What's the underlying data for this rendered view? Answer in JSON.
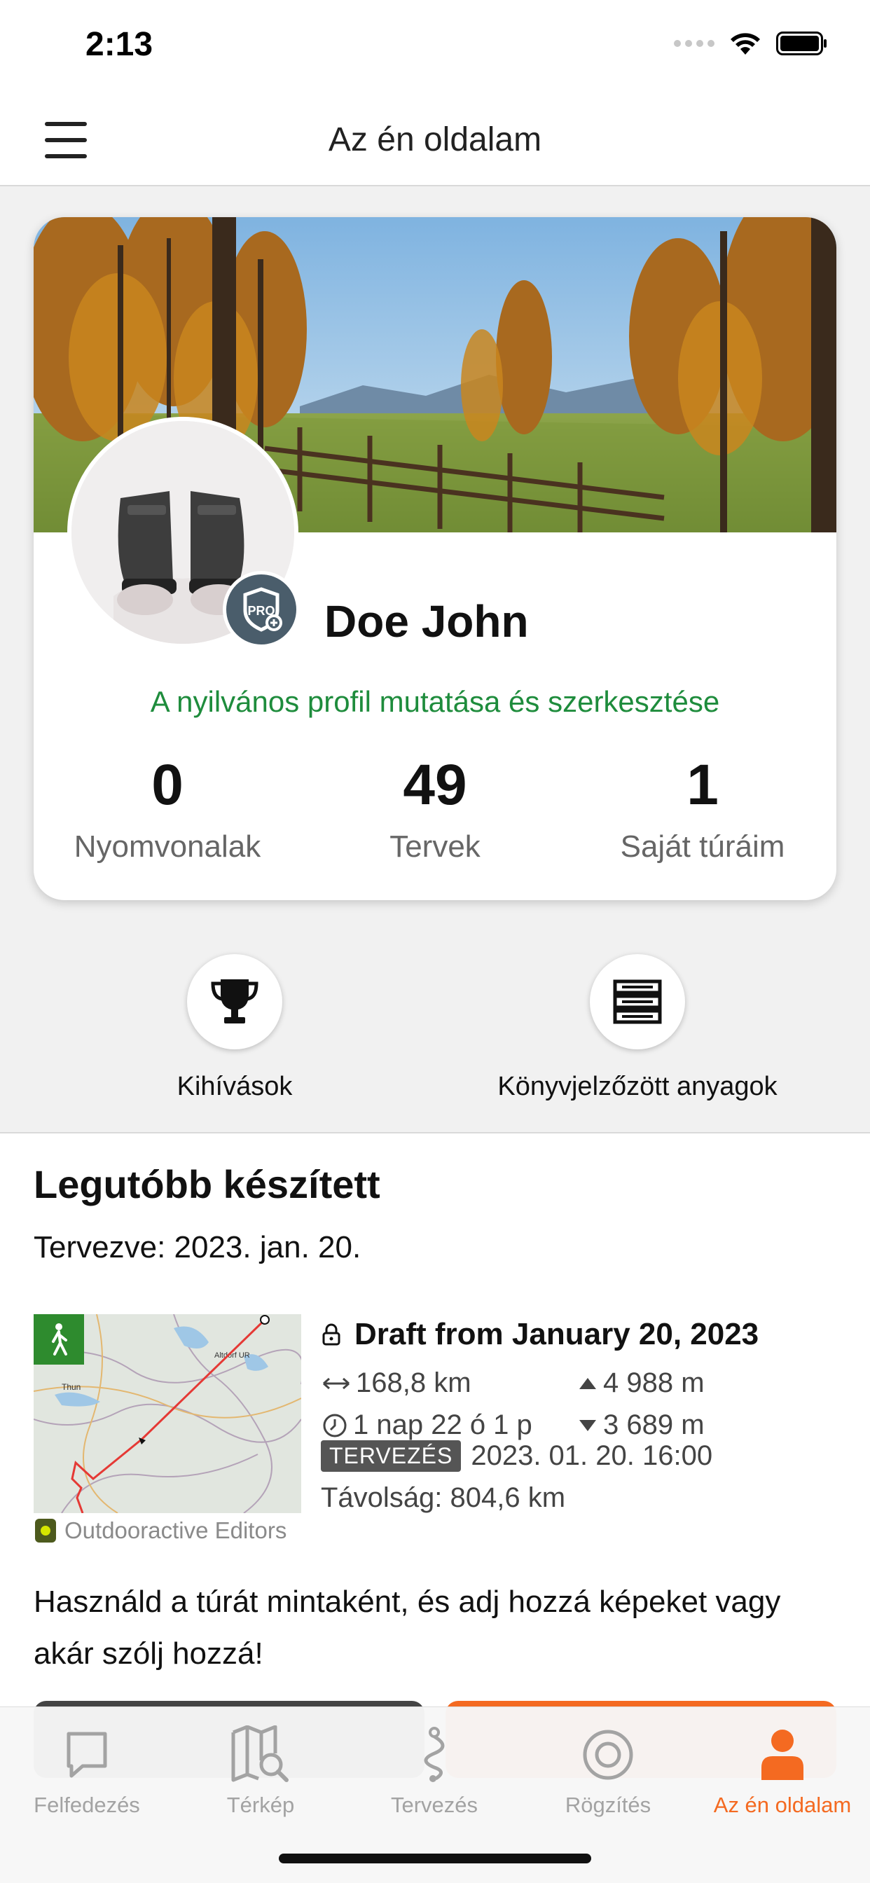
{
  "status_bar": {
    "time": "2:13",
    "icons": [
      "signal-icon",
      "wifi-icon",
      "battery-icon"
    ]
  },
  "header": {
    "title": "Az én oldalam",
    "menu_icon": "hamburger-menu-icon"
  },
  "profile": {
    "name": "Doe John",
    "badge": "PRO",
    "public_profile_link": "A nyilvános profil mutatása és szerkesztése",
    "stats": [
      {
        "value": "0",
        "label": "Nyomvonalak"
      },
      {
        "value": "49",
        "label": "Tervek"
      },
      {
        "value": "1",
        "label": "Saját túráim"
      }
    ]
  },
  "quick_actions": [
    {
      "label": "Kihívások",
      "icon": "trophy-icon"
    },
    {
      "label": "Könyvjelzőzött anyagok",
      "icon": "bookmarks-list-icon"
    }
  ],
  "recent": {
    "title": "Legutóbb készített",
    "planned_date": "Tervezve: 2023. jan. 20.",
    "tour": {
      "title": "Draft from January 20, 2023",
      "distance": "168,8 km",
      "ascent": "4 988 m",
      "duration": "1 nap 22 ó 1 p",
      "descent": "3 689 m",
      "status_badge": "TERVEZÉS",
      "datetime": "2023. 01. 20. 16:00",
      "total_distance": "Távolság: 804,6 km",
      "map_labels": {
        "city1": "Thun",
        "city2": "Altdorf UR"
      },
      "source": "Outdooractive Editors"
    },
    "description": "Használd a túrát mintaként, és adj hozzá képeket vagy akár szólj hozzá!"
  },
  "tabbar": {
    "tabs": [
      {
        "label": "Felfedezés",
        "icon": "explore-icon"
      },
      {
        "label": "Térkép",
        "icon": "map-search-icon"
      },
      {
        "label": "Tervezés",
        "icon": "route-planner-icon"
      },
      {
        "label": "Rögzítés",
        "icon": "record-icon"
      },
      {
        "label": "Az én oldalam",
        "icon": "person-icon"
      }
    ],
    "active_index": 4
  },
  "colors": {
    "accent": "#f46a21",
    "link_green": "#1e8c3c",
    "pro_badge": "#4a5d6b",
    "route_red": "#e53935"
  }
}
